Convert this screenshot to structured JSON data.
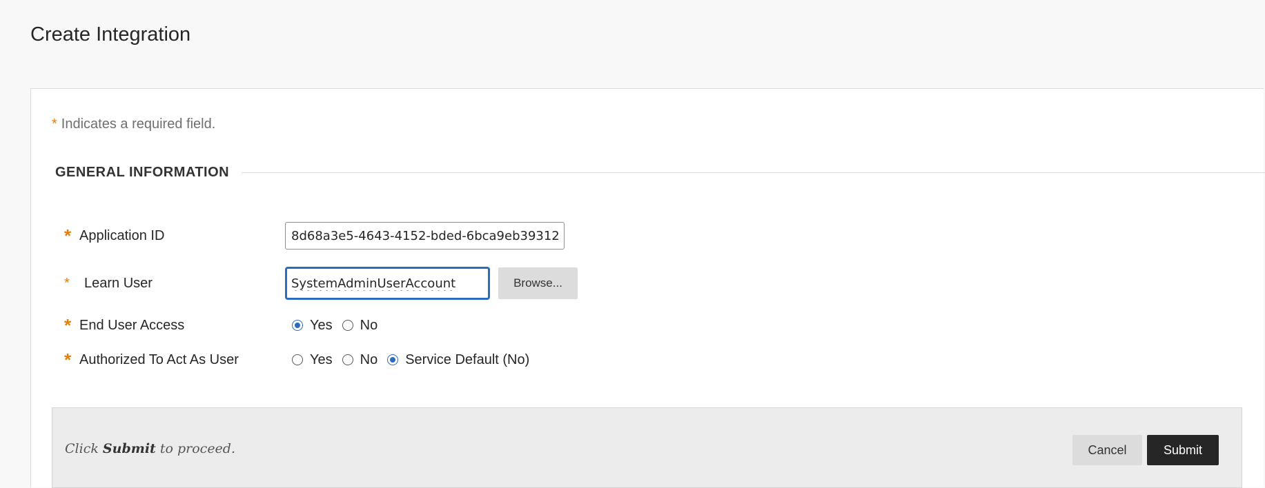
{
  "page": {
    "title": "Create Integration"
  },
  "form": {
    "required_note": "Indicates a required field.",
    "required_marker": "*",
    "section_title": "GENERAL INFORMATION",
    "fields": {
      "application_id": {
        "label": "Application ID",
        "value": "8d68a3e5-4643-4152-bded-6bca9eb39312"
      },
      "learn_user": {
        "label": "Learn User",
        "value": "SystemAdminUserAccount",
        "browse_label": "Browse..."
      },
      "end_user_access": {
        "label": "End User Access",
        "options": [
          "Yes",
          "No"
        ],
        "selected": "Yes"
      },
      "authorized_to_act": {
        "label": "Authorized To Act As User",
        "options": [
          "Yes",
          "No",
          "Service Default (No)"
        ],
        "selected": "Service Default (No)"
      }
    }
  },
  "submit_bar": {
    "hint_prefix": "Click",
    "hint_bold": "Submit",
    "hint_suffix": "to proceed.",
    "cancel_label": "Cancel",
    "submit_label": "Submit"
  },
  "colors": {
    "accent": "#2b6cbf",
    "required": "#e67e00",
    "submit_button": "#262626"
  }
}
